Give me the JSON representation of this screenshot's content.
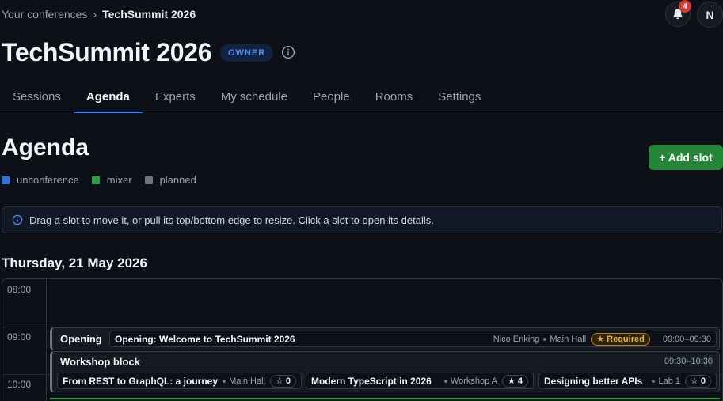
{
  "breadcrumb": {
    "parent": "Your conferences",
    "separator": "›",
    "current": "TechSummit 2026"
  },
  "notifications": {
    "count": "4"
  },
  "user": {
    "initial": "N"
  },
  "header": {
    "title": "TechSummit 2026",
    "role_badge": "OWNER"
  },
  "tabs": [
    {
      "label": "Sessions"
    },
    {
      "label": "Agenda",
      "active": true
    },
    {
      "label": "Experts"
    },
    {
      "label": "My schedule"
    },
    {
      "label": "People"
    },
    {
      "label": "Rooms"
    },
    {
      "label": "Settings"
    }
  ],
  "agenda": {
    "title": "Agenda",
    "add_button": "+ Add slot",
    "legend": [
      {
        "label": "unconference",
        "color": "#2f6fe0"
      },
      {
        "label": "mixer",
        "color": "#2ea043"
      },
      {
        "label": "planned",
        "color": "#6e7681"
      }
    ],
    "info_banner": "Drag a slot to move it, or pull its top/bottom edge to resize. Click a slot to open its details."
  },
  "day": {
    "title": "Thursday, 21 May 2026",
    "hours": [
      "08:00",
      "09:00",
      "10:00"
    ]
  },
  "slots": {
    "opening": {
      "label": "Opening",
      "session": {
        "title": "Opening: Welcome to TechSummit 2026",
        "speaker": "Nico Enking",
        "room": "Main Hall",
        "badge": "Required",
        "time": "09:00–09:30"
      }
    },
    "workshop": {
      "label": "Workshop block",
      "time": "09:30–10:30",
      "sessions": [
        {
          "title": "From REST to GraphQL: a journey",
          "room": "Main Hall",
          "stars": "0"
        },
        {
          "title": "Modern TypeScript in 2026",
          "room": "Workshop A",
          "stars": "4"
        },
        {
          "title": "Designing better APIs",
          "room": "Lab 1",
          "stars": "0"
        }
      ]
    }
  },
  "colors": {
    "accent": "#2f81f7",
    "primary_button": "#238636",
    "required": "#e3b341",
    "notification": "#da3633"
  }
}
